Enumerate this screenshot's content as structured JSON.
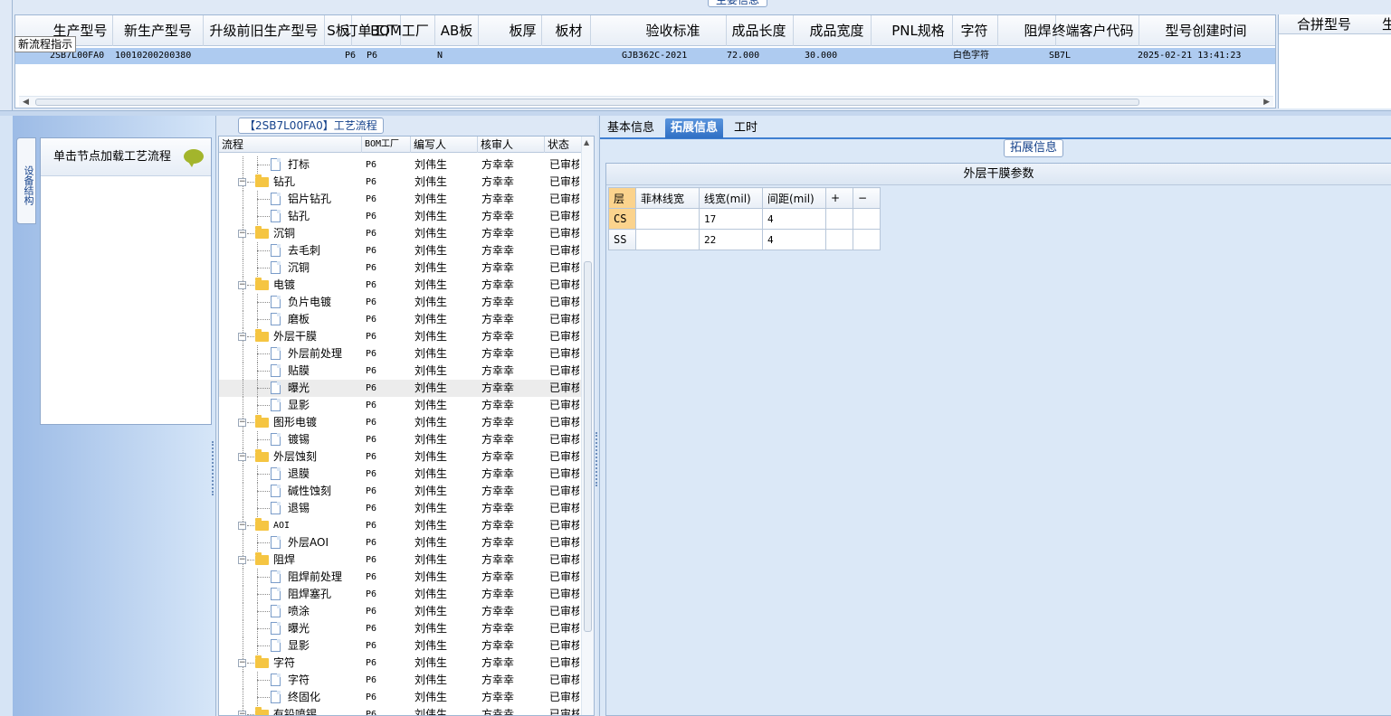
{
  "main_title": "主要信息",
  "tooltip": "新流程指示",
  "grid": {
    "columns": [
      "生产型号",
      "新生产型号",
      "升级前旧生产型号",
      "S板",
      "订单工厂",
      "BOM工厂",
      "AB板",
      "板厚",
      "板材",
      "验收标准",
      "成品长度",
      "成品宽度",
      "PNL规格",
      "字符",
      "阻焊",
      "终端客户代码",
      "型号创建时间"
    ],
    "row": {
      "生产型号": "2SB7L00FA0",
      "新生产型号": "10010200200380",
      "升级前旧生产型号": "",
      "S板": "",
      "订单工厂": "P6",
      "BOM工厂": "P6",
      "AB板": "N",
      "板厚": "",
      "板材": "",
      "验收标准": "GJB362C-2021",
      "成品长度": "72.000",
      "成品宽度": "30.000",
      "PNL规格": "",
      "字符": "白色字符",
      "阻焊": "",
      "终端客户代码": "SB7L",
      "型号创建时间": "2025-02-21 13:41:23"
    }
  },
  "merge_panel": {
    "header": "合拼型号",
    "header_next": "生"
  },
  "sidenav": {
    "vertical_tab": "设备结构",
    "panel_header": "单击节点加载工艺流程"
  },
  "tree": {
    "title": "【2SB7L00FA0】工艺流程",
    "columns": [
      "流程",
      "BOM工厂",
      "编写人",
      "核审人",
      "状态"
    ],
    "rows": [
      {
        "level": 1,
        "type": "file",
        "name": "打标",
        "bom": "P6",
        "writer": "刘伟生",
        "reviewer": "方幸幸",
        "status": "已审核"
      },
      {
        "level": 0,
        "type": "folder",
        "name": "钻孔",
        "bom": "P6",
        "writer": "刘伟生",
        "reviewer": "方幸幸",
        "status": "已审核"
      },
      {
        "level": 1,
        "type": "file",
        "name": "铝片钻孔",
        "bom": "P6",
        "writer": "刘伟生",
        "reviewer": "方幸幸",
        "status": "已审核"
      },
      {
        "level": 1,
        "type": "file",
        "name": "钻孔",
        "bom": "P6",
        "writer": "刘伟生",
        "reviewer": "方幸幸",
        "status": "已审核"
      },
      {
        "level": 0,
        "type": "folder",
        "name": "沉铜",
        "bom": "P6",
        "writer": "刘伟生",
        "reviewer": "方幸幸",
        "status": "已审核"
      },
      {
        "level": 1,
        "type": "file",
        "name": "去毛刺",
        "bom": "P6",
        "writer": "刘伟生",
        "reviewer": "方幸幸",
        "status": "已审核"
      },
      {
        "level": 1,
        "type": "file",
        "name": "沉铜",
        "bom": "P6",
        "writer": "刘伟生",
        "reviewer": "方幸幸",
        "status": "已审核"
      },
      {
        "level": 0,
        "type": "folder",
        "name": "电镀",
        "bom": "P6",
        "writer": "刘伟生",
        "reviewer": "方幸幸",
        "status": "已审核"
      },
      {
        "level": 1,
        "type": "file",
        "name": "负片电镀",
        "bom": "P6",
        "writer": "刘伟生",
        "reviewer": "方幸幸",
        "status": "已审核"
      },
      {
        "level": 1,
        "type": "file",
        "name": "磨板",
        "bom": "P6",
        "writer": "刘伟生",
        "reviewer": "方幸幸",
        "status": "已审核"
      },
      {
        "level": 0,
        "type": "folder",
        "name": "外层干膜",
        "bom": "P6",
        "writer": "刘伟生",
        "reviewer": "方幸幸",
        "status": "已审核"
      },
      {
        "level": 1,
        "type": "file",
        "name": "外层前处理",
        "bom": "P6",
        "writer": "刘伟生",
        "reviewer": "方幸幸",
        "status": "已审核"
      },
      {
        "level": 1,
        "type": "file",
        "name": "贴膜",
        "bom": "P6",
        "writer": "刘伟生",
        "reviewer": "方幸幸",
        "status": "已审核"
      },
      {
        "level": 1,
        "type": "file",
        "name": "曝光",
        "bom": "P6",
        "writer": "刘伟生",
        "reviewer": "方幸幸",
        "status": "已审核",
        "selected": true
      },
      {
        "level": 1,
        "type": "file",
        "name": "显影",
        "bom": "P6",
        "writer": "刘伟生",
        "reviewer": "方幸幸",
        "status": "已审核"
      },
      {
        "level": 0,
        "type": "folder",
        "name": "图形电镀",
        "bom": "P6",
        "writer": "刘伟生",
        "reviewer": "方幸幸",
        "status": "已审核"
      },
      {
        "level": 1,
        "type": "file",
        "name": "镀锡",
        "bom": "P6",
        "writer": "刘伟生",
        "reviewer": "方幸幸",
        "status": "已审核"
      },
      {
        "level": 0,
        "type": "folder",
        "name": "外层蚀刻",
        "bom": "P6",
        "writer": "刘伟生",
        "reviewer": "方幸幸",
        "status": "已审核"
      },
      {
        "level": 1,
        "type": "file",
        "name": "退膜",
        "bom": "P6",
        "writer": "刘伟生",
        "reviewer": "方幸幸",
        "status": "已审核"
      },
      {
        "level": 1,
        "type": "file",
        "name": "碱性蚀刻",
        "bom": "P6",
        "writer": "刘伟生",
        "reviewer": "方幸幸",
        "status": "已审核"
      },
      {
        "level": 1,
        "type": "file",
        "name": "退锡",
        "bom": "P6",
        "writer": "刘伟生",
        "reviewer": "方幸幸",
        "status": "已审核"
      },
      {
        "level": 0,
        "type": "folder",
        "name": "AOI",
        "bom": "P6",
        "writer": "刘伟生",
        "reviewer": "方幸幸",
        "status": "已审核"
      },
      {
        "level": 1,
        "type": "file",
        "name": "外层AOI",
        "bom": "P6",
        "writer": "刘伟生",
        "reviewer": "方幸幸",
        "status": "已审核"
      },
      {
        "level": 0,
        "type": "folder",
        "name": "阻焊",
        "bom": "P6",
        "writer": "刘伟生",
        "reviewer": "方幸幸",
        "status": "已审核"
      },
      {
        "level": 1,
        "type": "file",
        "name": "阻焊前处理",
        "bom": "P6",
        "writer": "刘伟生",
        "reviewer": "方幸幸",
        "status": "已审核"
      },
      {
        "level": 1,
        "type": "file",
        "name": "阻焊塞孔",
        "bom": "P6",
        "writer": "刘伟生",
        "reviewer": "方幸幸",
        "status": "已审核"
      },
      {
        "level": 1,
        "type": "file",
        "name": "喷涂",
        "bom": "P6",
        "writer": "刘伟生",
        "reviewer": "方幸幸",
        "status": "已审核"
      },
      {
        "level": 1,
        "type": "file",
        "name": "曝光",
        "bom": "P6",
        "writer": "刘伟生",
        "reviewer": "方幸幸",
        "status": "已审核"
      },
      {
        "level": 1,
        "type": "file",
        "name": "显影",
        "bom": "P6",
        "writer": "刘伟生",
        "reviewer": "方幸幸",
        "status": "已审核"
      },
      {
        "level": 0,
        "type": "folder",
        "name": "字符",
        "bom": "P6",
        "writer": "刘伟生",
        "reviewer": "方幸幸",
        "status": "已审核"
      },
      {
        "level": 1,
        "type": "file",
        "name": "字符",
        "bom": "P6",
        "writer": "刘伟生",
        "reviewer": "方幸幸",
        "status": "已审核"
      },
      {
        "level": 1,
        "type": "file",
        "name": "终固化",
        "bom": "P6",
        "writer": "刘伟生",
        "reviewer": "方幸幸",
        "status": "已审核"
      },
      {
        "level": 0,
        "type": "folder",
        "name": "有铅喷锡",
        "bom": "P6",
        "writer": "刘伟生",
        "reviewer": "方幸幸",
        "status": "已审核"
      }
    ]
  },
  "tabs": [
    {
      "label": "基本信息",
      "active": false
    },
    {
      "label": "拓展信息",
      "active": true
    },
    {
      "label": "工时",
      "active": false
    }
  ],
  "ext": {
    "title": "拓展信息",
    "section_header": "外层干膜参数",
    "columns": [
      "层",
      "菲林线宽",
      "线宽(mil)",
      "间距(mil)",
      "+",
      "−"
    ],
    "rows": [
      {
        "layer": "CS",
        "film_width": "",
        "width": "17",
        "spacing": "4",
        "plus": "",
        "minus": ""
      },
      {
        "layer": "SS",
        "film_width": "",
        "width": "22",
        "spacing": "4",
        "plus": "",
        "minus": ""
      }
    ]
  },
  "colors": {
    "row_selected": "#aecbf0",
    "tab_active": "#2f6fc4",
    "folder": "#f5c542",
    "header_highlight": "#fbd38d"
  }
}
